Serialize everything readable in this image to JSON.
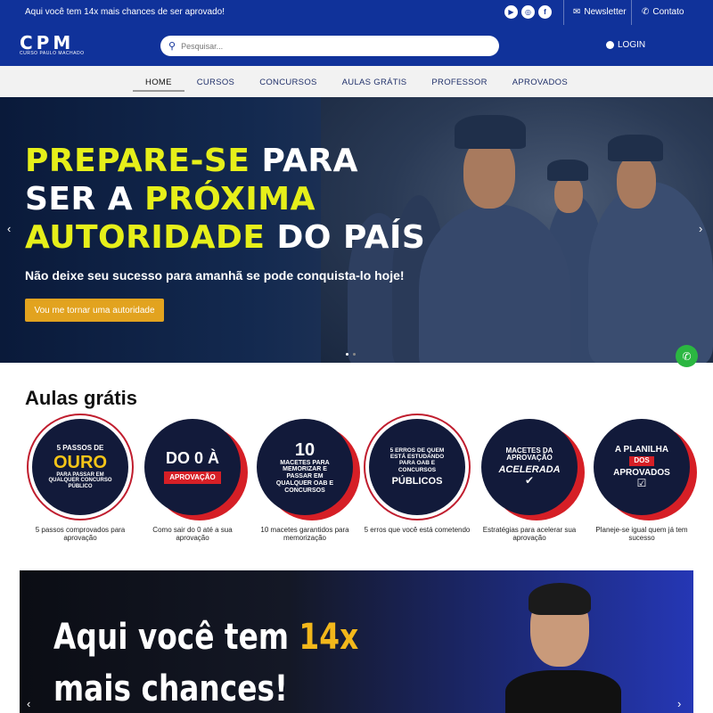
{
  "topbar": {
    "message": "Aqui você tem 14x mais chances de ser aprovado!",
    "socials": [
      "youtube-icon",
      "instagram-icon",
      "facebook-icon"
    ],
    "newsletter_label": "Newsletter",
    "contact_label": "Contato"
  },
  "header": {
    "logo_big": "CPM",
    "logo_small": "CURSO PAULO MACHADO",
    "search_placeholder": "Pesquisar...",
    "login_label": "LOGIN"
  },
  "nav": {
    "items": [
      "HOME",
      "CURSOS",
      "CONCURSOS",
      "AULAS GRÁTIS",
      "PROFESSOR",
      "APROVADOS"
    ],
    "active": "HOME"
  },
  "hero": {
    "line1_yellow": "PREPARE-SE",
    "line1_white": " PARA",
    "line2_white": "SER A ",
    "line2_yellow": "PRÓXIMA",
    "line3_yellow": "AUTORIDADE",
    "line3_white": " DO PAÍS",
    "subtitle": "Não deixe seu sucesso para amanhã se pode conquista-lo hoje!",
    "cta_label": "Vou me tornar uma autoridade"
  },
  "aulas": {
    "title": "Aulas grátis",
    "cards": [
      {
        "badge_top": "5 PASSOS DE",
        "badge_big": "OURO",
        "badge_bottom": "PARA PASSAR EM QUALQUER CONCURSO PÚBLICO",
        "caption": "5 passos comprovados para aprovação"
      },
      {
        "badge_top": "DO 0 À",
        "badge_big": "",
        "badge_bottom": "APROVAÇÃO",
        "caption": "Como sair do 0 até a sua aprovação"
      },
      {
        "badge_top": "10",
        "badge_big": "",
        "badge_bottom": "MACETES PARA MEMORIZAR E PASSAR EM QUALQUER OAB E CONCURSOS",
        "caption": "10 macetes garantidos para memorização"
      },
      {
        "badge_top": "5 ERROS DE QUEM ESTÁ ESTUDANDO PARA OAB E CONCURSOS",
        "badge_big": "",
        "badge_bottom": "PÚBLICOS",
        "caption": "5 erros que você está cometendo"
      },
      {
        "badge_top": "MACETES DA APROVAÇÃO",
        "badge_big": "",
        "badge_bottom": "ACELERADA",
        "caption": "Estratégias para acelerar sua aprovação"
      },
      {
        "badge_top": "A PLANILHA",
        "badge_big": "DOS",
        "badge_bottom": "APROVADOS",
        "caption": "Planeje-se igual quem já tem sucesso"
      }
    ]
  },
  "banner2": {
    "line1_white": "Aqui você tem ",
    "line1_orange": "14x",
    "line2": "mais chances!"
  },
  "colors": {
    "brand_blue": "#10329a",
    "hero_yellow": "#e6ef1a",
    "cta_orange": "#e2a31f",
    "whatsapp_green": "#2bb741"
  }
}
